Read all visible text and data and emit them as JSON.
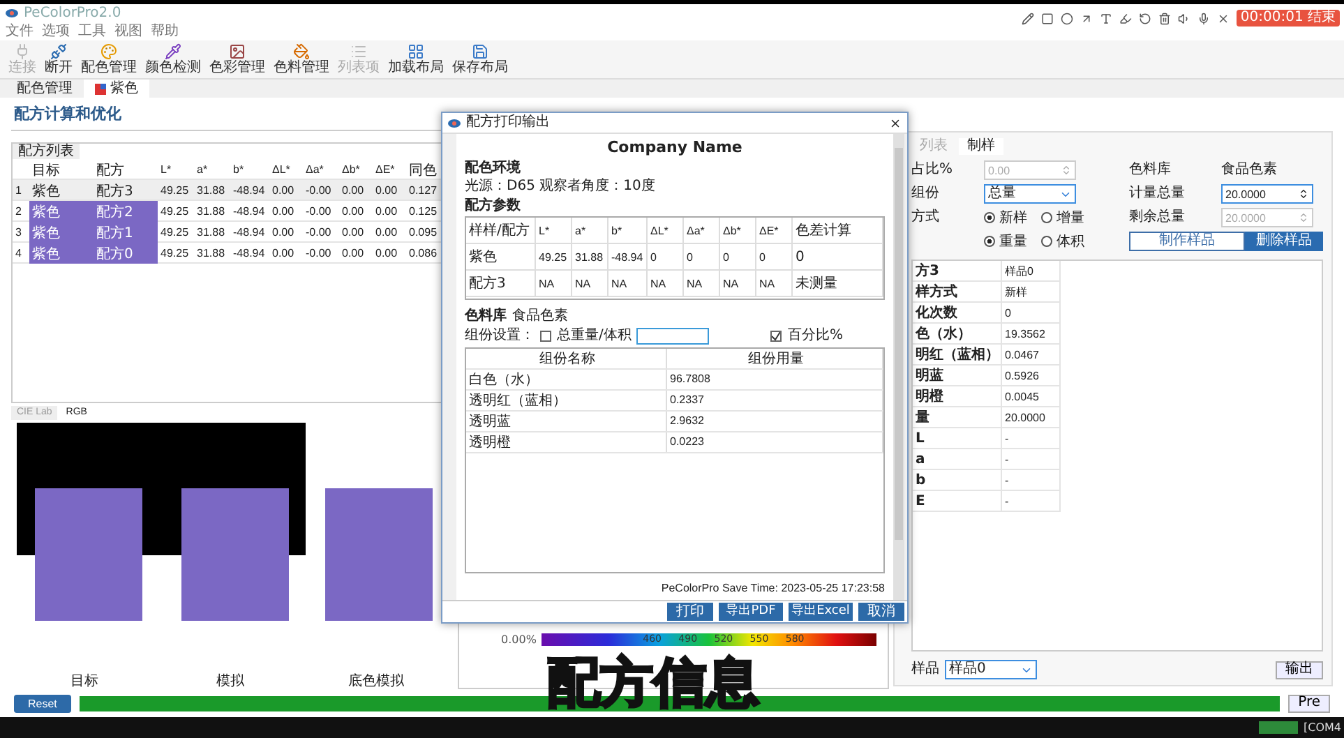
{
  "app": {
    "title": "PeColorPro2.0"
  },
  "recorder": {
    "timer": "00:00:01 结束"
  },
  "menu": [
    "文件",
    "选项",
    "工具",
    "视图",
    "帮助"
  ],
  "toolbar": [
    {
      "label": "连接",
      "disabled": true
    },
    {
      "label": "断开",
      "disabled": false
    },
    {
      "label": "配色管理",
      "disabled": false
    },
    {
      "label": "颜色检测",
      "disabled": false
    },
    {
      "label": "色彩管理",
      "disabled": false
    },
    {
      "label": "色料管理",
      "disabled": false
    },
    {
      "label": "列表项",
      "disabled": true
    },
    {
      "label": "加载布局",
      "disabled": false
    },
    {
      "label": "保存布局",
      "disabled": false
    }
  ],
  "doc_tabs": [
    {
      "label": "配色管理",
      "selected": false
    },
    {
      "label": "紫色",
      "selected": true
    }
  ],
  "heading": "配方计算和优化",
  "recipe_list": {
    "title": "配方列表",
    "columns": [
      "目标",
      "配方",
      "L*",
      "a*",
      "b*",
      "ΔL*",
      "Δa*",
      "Δb*",
      "ΔE*",
      "同色"
    ],
    "rows": [
      {
        "index": "1",
        "selected": false,
        "cells": [
          "紫色",
          "配方3",
          "49.25",
          "31.88",
          "-48.94",
          "0.00",
          "-0.00",
          "0.00",
          "0.00",
          "0.127"
        ]
      },
      {
        "index": "2",
        "selected": true,
        "cells": [
          "紫色",
          "配方2",
          "49.25",
          "31.88",
          "-48.94",
          "0.00",
          "-0.00",
          "0.00",
          "0.00",
          "0.125"
        ]
      },
      {
        "index": "3",
        "selected": true,
        "cells": [
          "紫色",
          "配方1",
          "49.25",
          "31.88",
          "-48.94",
          "0.00",
          "-0.00",
          "0.00",
          "0.00",
          "0.095"
        ]
      },
      {
        "index": "4",
        "selected": true,
        "cells": [
          "紫色",
          "配方0",
          "49.25",
          "31.88",
          "-48.94",
          "0.00",
          "-0.00",
          "0.00",
          "0.00",
          "0.086"
        ]
      }
    ]
  },
  "swatch_tabs": [
    {
      "label": "CIE Lab",
      "selected": false
    },
    {
      "label": "RGB",
      "selected": true
    }
  ],
  "swatch_labels": [
    "目标",
    "模拟",
    "底色模拟"
  ],
  "spectrum": {
    "percent": "0.00%",
    "ticks": [
      "460",
      "490",
      "520",
      "550",
      "580"
    ]
  },
  "dialog": {
    "title": "配方打印输出",
    "company": "Company Name",
    "env_title": "配色环境",
    "env_text": "光源：D65 观察者角度：10度",
    "params_title": "配方参数",
    "params_columns": [
      "样样/配方",
      "L*",
      "a*",
      "b*",
      "ΔL*",
      "Δa*",
      "Δb*",
      "ΔE*",
      "色差计算"
    ],
    "params_rows": [
      [
        "紫色",
        "49.25",
        "31.88",
        "-48.94",
        "0",
        "0",
        "0",
        "0",
        "0"
      ],
      [
        "配方3",
        "NA",
        "NA",
        "NA",
        "NA",
        "NA",
        "NA",
        "NA",
        "未测量"
      ]
    ],
    "library_label": "色料库",
    "library_value": "食品色素",
    "settings_label": "组份设置：",
    "total_checkbox": {
      "label": "总重量/体积",
      "checked": false
    },
    "amount_field": {
      "focused": true
    },
    "percent_checkbox": {
      "label": "百分比%",
      "checked": true
    },
    "components_columns": [
      "组份名称",
      "组份用量"
    ],
    "components": [
      [
        "白色（水）",
        "96.7808"
      ],
      [
        "透明红（蓝相）",
        "0.2337"
      ],
      [
        "透明蓝",
        "2.9632"
      ],
      [
        "透明橙",
        "0.0223"
      ]
    ],
    "save_time": "PeColorPro Save Time: 2023-05-25 17:23:58",
    "buttons": [
      "打印",
      "导出PDF",
      "导出Excel",
      "取消"
    ]
  },
  "side_panel": {
    "tabs": [
      {
        "label": "列表",
        "selected": false
      },
      {
        "label": "制样",
        "selected": true
      }
    ],
    "percent_label": "占比%",
    "percent_field": {
      "value": "0.00",
      "disabled": true
    },
    "library_label": "色料库",
    "library_value": "食品色素",
    "group_label": "组份",
    "group_select": "总量",
    "total_label": "计量总量",
    "total_field": {
      "value": "20.0000",
      "disabled": false,
      "focused": true
    },
    "mode_label": "方式",
    "mode_options": [
      {
        "label": "新样",
        "selected": true
      },
      {
        "label": "增量",
        "selected": false
      }
    ],
    "remain_label": "剩余总量",
    "remain_field": {
      "value": "20.0000",
      "disabled": true,
      "focused": false
    },
    "unit_options": [
      {
        "label": "重量",
        "selected": true
      },
      {
        "label": "体积",
        "selected": false
      }
    ],
    "make_button": "制作样品",
    "delete_button": "删除样品",
    "table": [
      [
        "方3",
        "样品0"
      ],
      [
        "样方式",
        "新样"
      ],
      [
        "化次数",
        "0"
      ],
      [
        "色（水）",
        "19.3562"
      ],
      [
        "明红（蓝相）",
        "0.0467"
      ],
      [
        "明蓝",
        "0.5926"
      ],
      [
        "明橙",
        "0.0045"
      ],
      [
        "量",
        "20.0000"
      ],
      [
        "L",
        "-"
      ],
      [
        "a",
        "-"
      ],
      [
        "b",
        "-"
      ],
      [
        "E",
        "-"
      ]
    ],
    "sample_label": "样品",
    "sample_select": "样品0",
    "output_button": "输出"
  },
  "bottom": {
    "reset": "Reset",
    "progress": {
      "level": 1
    },
    "pre": "Pre"
  },
  "taskbar": {
    "port": "[COM4"
  },
  "caption": "配方信息"
}
